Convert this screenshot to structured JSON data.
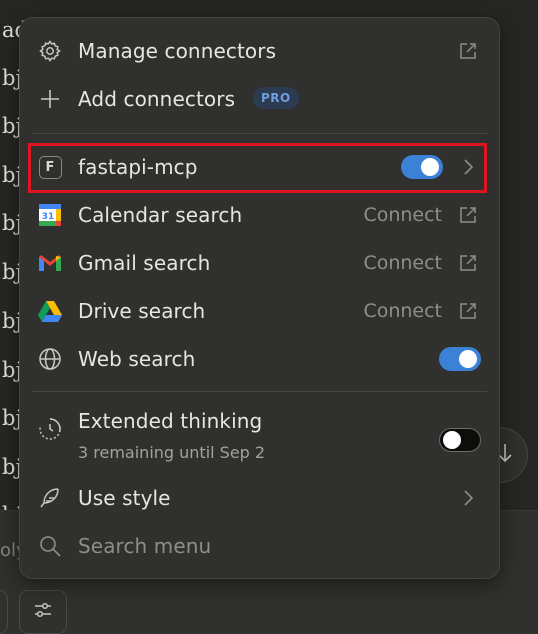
{
  "background": {
    "text_fragments": [
      "ad",
      "bj",
      "bj",
      "bj",
      "bj",
      "bj",
      "bj",
      "bj",
      "bj",
      "bj",
      "bj"
    ],
    "reply_fragment": "oly"
  },
  "menu": {
    "manage_connectors": {
      "label": "Manage connectors",
      "icon": "gear-icon",
      "trailing_icon": "external-link-icon"
    },
    "add_connectors": {
      "label": "Add connectors",
      "badge": "PRO",
      "icon": "plus-icon"
    },
    "connectors": [
      {
        "name": "fastapi-mcp",
        "icon_letter": "F",
        "toggle": "on",
        "highlighted": true
      },
      {
        "name": "Calendar search",
        "action": "Connect",
        "icon": "google-calendar-icon"
      },
      {
        "name": "Gmail search",
        "action": "Connect",
        "icon": "gmail-icon"
      },
      {
        "name": "Drive search",
        "action": "Connect",
        "icon": "google-drive-icon"
      },
      {
        "name": "Web search",
        "toggle": "on",
        "icon": "globe-icon"
      }
    ],
    "extended_thinking": {
      "label": "Extended thinking",
      "subtext": "3 remaining until Sep 2",
      "toggle": "off",
      "icon": "clock-icon"
    },
    "use_style": {
      "label": "Use style",
      "icon": "feather-icon"
    },
    "search": {
      "placeholder": "Search menu",
      "icon": "search-icon"
    }
  },
  "colors": {
    "accent": "#3b82d6",
    "highlight_border": "#e0141e",
    "menu_bg": "#30302e"
  }
}
